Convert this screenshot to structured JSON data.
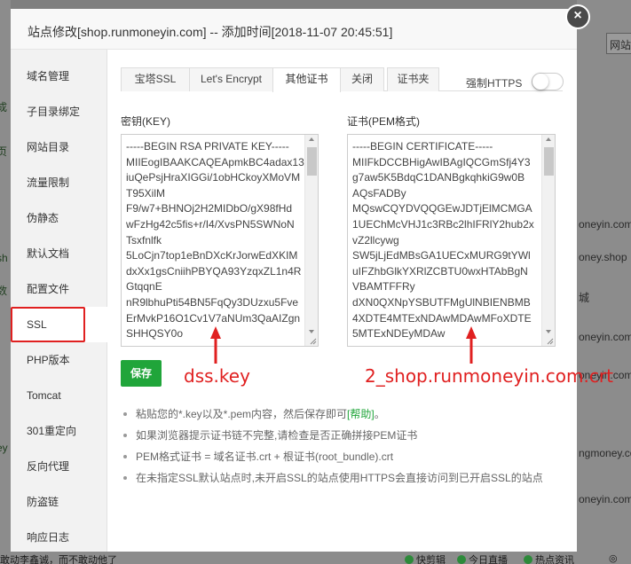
{
  "modal": {
    "title": "站点修改[shop.runmoneyin.com] -- 添加时间[2018-11-07 20:45:51]",
    "close_symbol": "×"
  },
  "sidebar": {
    "items": [
      {
        "label": "域名管理"
      },
      {
        "label": "子目录绑定"
      },
      {
        "label": "网站目录"
      },
      {
        "label": "流量限制"
      },
      {
        "label": "伪静态"
      },
      {
        "label": "默认文档"
      },
      {
        "label": "配置文件"
      },
      {
        "label": "SSL"
      },
      {
        "label": "PHP版本"
      },
      {
        "label": "Tomcat"
      },
      {
        "label": "301重定向"
      },
      {
        "label": "反向代理"
      },
      {
        "label": "防盗链"
      },
      {
        "label": "响应日志"
      }
    ],
    "active_index": 7
  },
  "tabs": [
    {
      "label": "宝塔SSL"
    },
    {
      "label": "Let's Encrypt"
    },
    {
      "label": "其他证书"
    },
    {
      "label": "关闭"
    },
    {
      "label": "证书夹"
    }
  ],
  "active_tab": 2,
  "force_https": {
    "label": "强制HTTPS",
    "enabled": false
  },
  "key_field": {
    "label": "密钥(KEY)",
    "lines": [
      "-----BEGIN RSA PRIVATE KEY-----",
      "MIIEogIBAAKCAQEApmkBC4adax13",
      "iuQePsjHraXIGGi/1obHCkoyXMoVM",
      "T95XilM",
      "F9/w7+BHNOj2H2MIDbO/gX98fHd",
      "wFzHg42c5fis+r/I4/XvsPN5SWNoN",
      "Tsxfnlfk",
      "5LoCjn7top1eBnDXcKrJorwEdXKIM",
      "dxXx1gsCniihPBYQA93YzqxZL1n4R",
      "GtqqnE",
      "nR9lbhuPti54BN5FqQy3DUzxu5Fve",
      "ErMvkP16O1Cv1V7aNUm3QaAIZgn",
      "SHHQSY0o"
    ]
  },
  "cert_field": {
    "label": "证书(PEM格式)",
    "lines": [
      "-----BEGIN CERTIFICATE-----",
      "MIIFkDCCBHigAwIBAgIQCGmSfj4Y3",
      "g7aw5K5BdqC1DANBgkqhkiG9w0B",
      "AQsFADBy",
      "MQswCQYDVQQGEwJDTjElMCMGA",
      "1UEChMcVHJ1c3RBc2lhIFRlY2hub2x",
      "vZ2llcywg",
      "SW5jLjEdMBsGA1UECxMURG9tYWl",
      "uIFZhbGlkYXRlZCBTU0wxHTAbBgN",
      "VBAMTFFRy",
      "dXN0QXNpYSBUTFMgUlNBIENBMB",
      "4XDTE4MTExNDAwMDAwMFoXDTE",
      "5MTExNDEyMDAw"
    ]
  },
  "save_button": {
    "label": "保存"
  },
  "annotations": {
    "key_file": "dss.key",
    "cert_file": "2_shop.runmoneyin.com.crt"
  },
  "tips": [
    {
      "text": "粘贴您的*.key以及*.pem内容，然后保存即可",
      "help": "[帮助]",
      "suffix": "。"
    },
    {
      "text": "如果浏览器提示证书链不完整,请检查是否正确拼接PEM证书"
    },
    {
      "text": "PEM格式证书 = 域名证书.crt + 根证书(root_bundle).crt"
    },
    {
      "text": "在未指定SSL默认站点时,未开启SSL的站点使用HTTPS会直接访问到已开启SSL的站点"
    }
  ],
  "background": {
    "left_fragments": [
      "成",
      "页",
      "sh",
      "ey",
      "数"
    ],
    "right_fragments": [
      "oneyin.com",
      "oney.shop",
      "城",
      "oneyin.com",
      "oneyin.com",
      "ngmoney.com",
      "oneyin.com"
    ],
    "right_box_text": "网站",
    "bottom_left": "敢动李鑫诚，而不敢动他了",
    "bottom_items": [
      "快剪辑",
      "今日直播",
      "热点资讯"
    ],
    "bottom_right_glyph": "◎"
  },
  "colors": {
    "accent_green": "#20a53a",
    "annotation_red": "#e02020"
  }
}
